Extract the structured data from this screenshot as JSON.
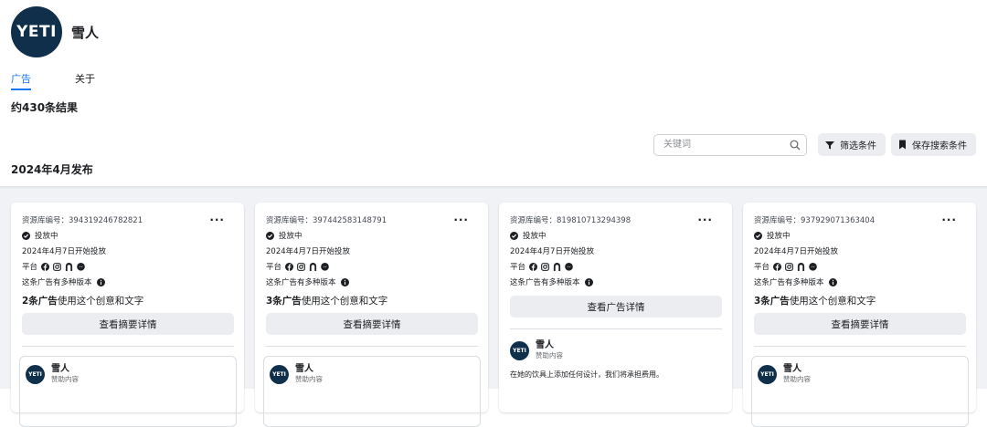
{
  "page": {
    "logo_text": "YETI",
    "name": "雪人"
  },
  "tabs": [
    {
      "label": "广告",
      "active": true
    },
    {
      "label": "关于",
      "active": false
    }
  ],
  "results": {
    "count_text": "约430条结果",
    "date_heading": "2024年4月发布"
  },
  "toolbar": {
    "search_placeholder": "关键词",
    "filter_label": "筛选条件",
    "save_label": "保存搜索条件"
  },
  "cards": [
    {
      "library_id": "资源库编号：394319246782821",
      "status": "投放中",
      "start_date": "2024年4月7日开始投放",
      "platform_label": "平台",
      "versions_note": "这条广告有多种版本",
      "usage_count": "2条广告",
      "usage_rest": "使用这个创意和文字",
      "view_button": "查看摘要详情",
      "advertiser": "雪人",
      "sponsored": "赞助内容",
      "body": ""
    },
    {
      "library_id": "资源库编号：397442583148791",
      "status": "投放中",
      "start_date": "2024年4月7日开始投放",
      "platform_label": "平台",
      "versions_note": "这条广告有多种版本",
      "usage_count": "3条广告",
      "usage_rest": "使用这个创意和文字",
      "view_button": "查看摘要详情",
      "advertiser": "雪人",
      "sponsored": "赞助内容",
      "body": ""
    },
    {
      "library_id": "资源库编号：819810713294398",
      "status": "投放中",
      "start_date": "2024年4月7日开始投放",
      "platform_label": "平台",
      "versions_note": "这条广告有多种版本",
      "view_button": "查看广告详情",
      "advertiser": "雪人",
      "sponsored": "赞助内容",
      "body": "在她的饮具上添加任何设计，我们将承担费用。"
    },
    {
      "library_id": "资源库编号：937929071363404",
      "status": "投放中",
      "start_date": "2024年4月7日开始投放",
      "platform_label": "平台",
      "versions_note": "这条广告有多种版本",
      "usage_count": "3条广告",
      "usage_rest": "使用这个创意和文字",
      "view_button": "查看摘要详情",
      "advertiser": "雪人",
      "sponsored": "赞助内容",
      "body": ""
    }
  ],
  "icons": {
    "platforms": [
      "facebook-icon",
      "instagram-icon",
      "audience-network-icon",
      "messenger-icon"
    ],
    "status": "check-circle-icon",
    "info": "info-icon"
  },
  "colors": {
    "brand": "#0f2f4a",
    "accent": "#1877f2"
  }
}
